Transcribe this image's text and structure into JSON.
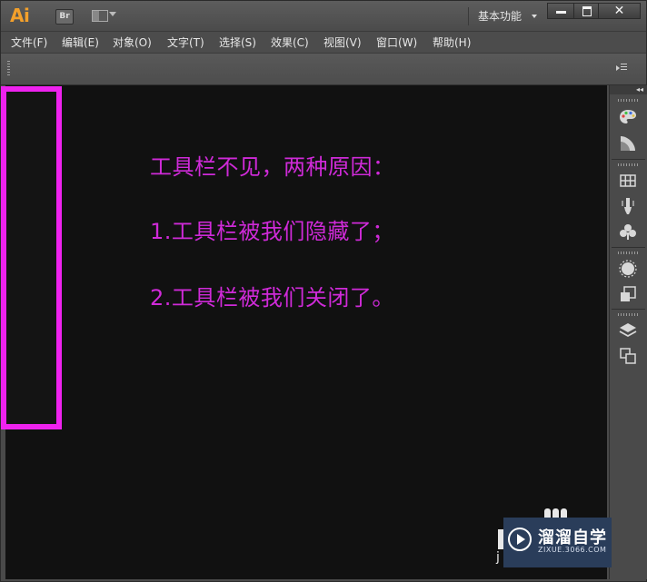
{
  "titlebar": {
    "logo": "Ai",
    "bridge_label": "Br",
    "workspace": "基本功能",
    "close_glyph": "✕"
  },
  "menu": [
    {
      "label": "文件(F)"
    },
    {
      "label": "编辑(E)"
    },
    {
      "label": "对象(O)"
    },
    {
      "label": "文字(T)"
    },
    {
      "label": "选择(S)"
    },
    {
      "label": "效果(C)"
    },
    {
      "label": "视图(V)"
    },
    {
      "label": "窗口(W)"
    },
    {
      "label": "帮助(H)"
    }
  ],
  "canvas": {
    "notes": [
      "工具栏不见，两种原因：",
      "1.工具栏被我们隐藏了；",
      "2.工具栏被我们关闭了。"
    ]
  },
  "dock": {
    "collapse_glyph": "◂◂",
    "icons": [
      "color-palette-icon",
      "color-guide-icon",
      "swatches-icon",
      "brushes-icon",
      "symbols-icon",
      "stroke-icon",
      "transparency-icon",
      "layers-icon",
      "artboards-icon"
    ]
  },
  "watermark": {
    "title": "溜溜自学",
    "url": "ZIXUE.3066.COM",
    "partial_text": "j"
  },
  "colors": {
    "accent_logo": "#f3a02b",
    "annotation": "#cf2ad8",
    "highlight_border": "#ee22ee",
    "canvas_bg": "#111111",
    "chrome_bg": "#4a4a4a"
  }
}
